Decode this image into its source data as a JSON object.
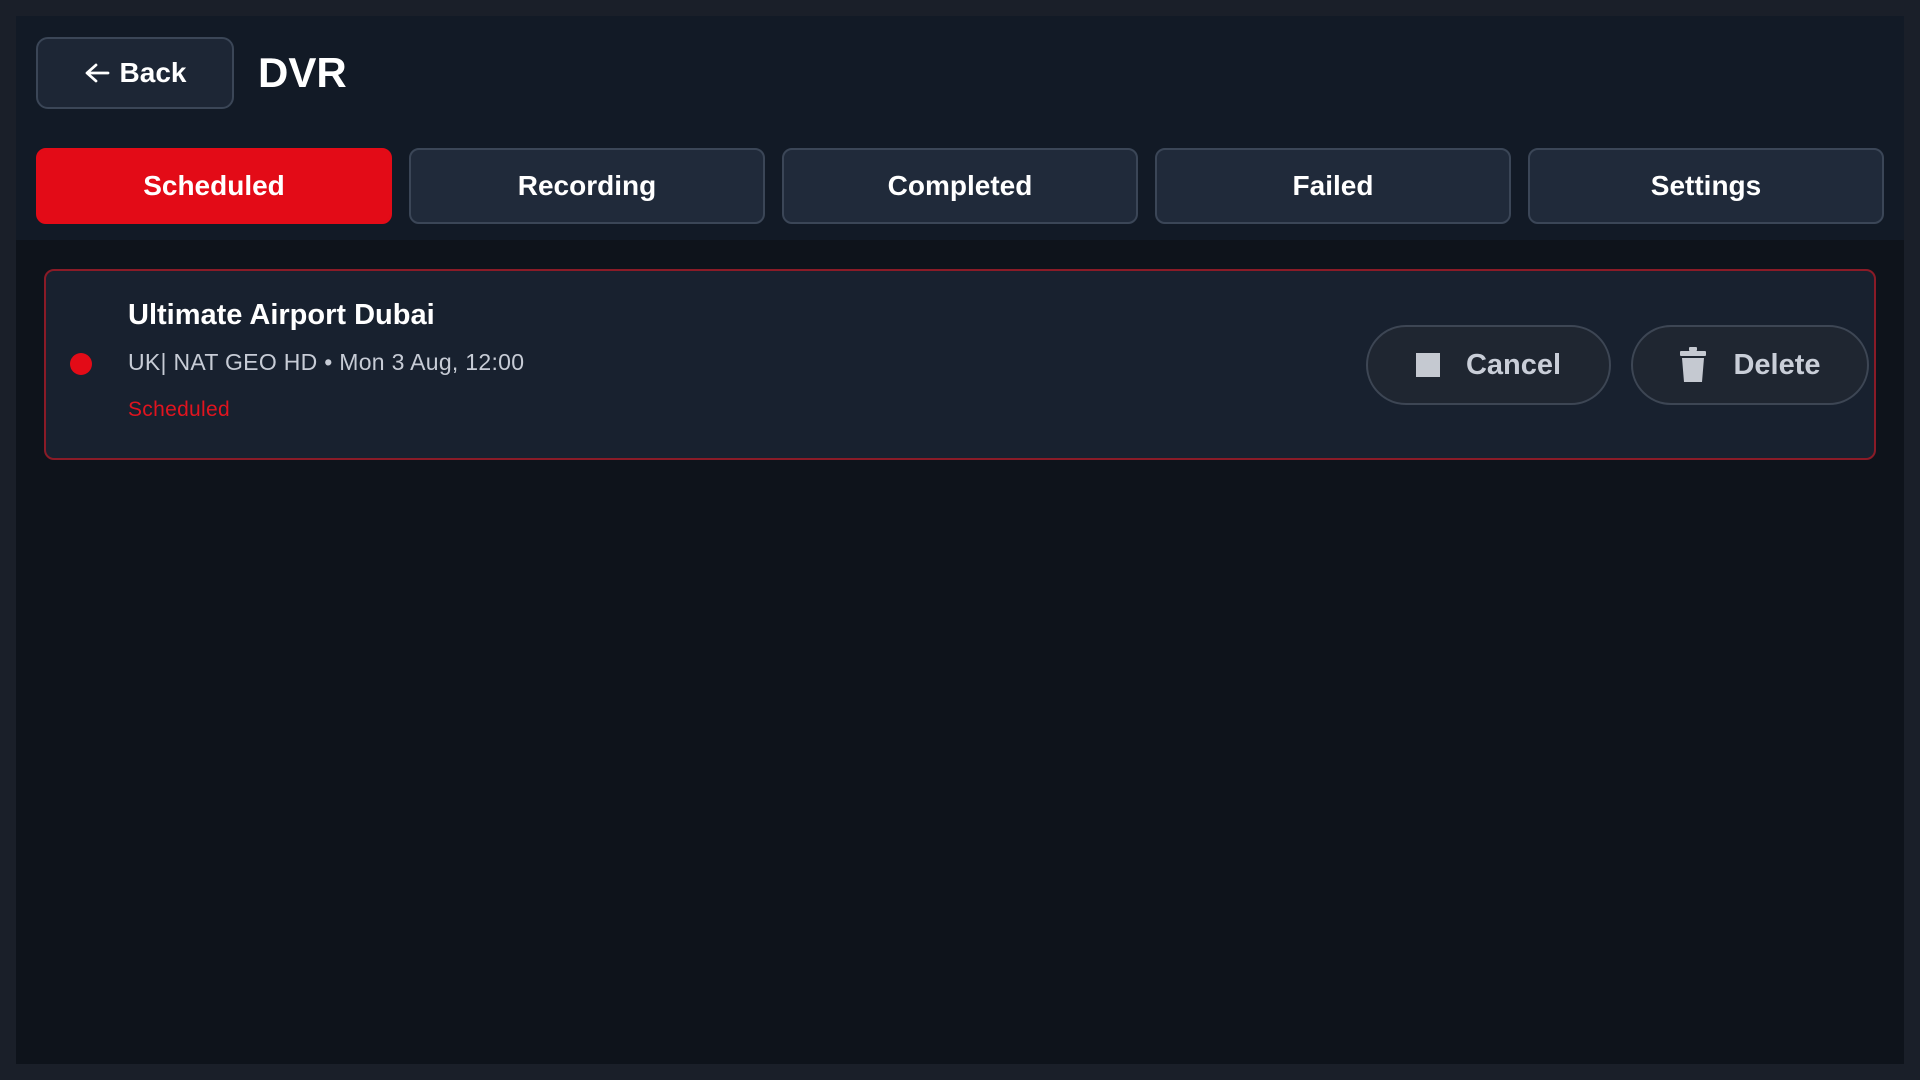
{
  "header": {
    "back_label": "Back",
    "title": "DVR"
  },
  "tabs": [
    {
      "label": "Scheduled",
      "active": true
    },
    {
      "label": "Recording",
      "active": false
    },
    {
      "label": "Completed",
      "active": false
    },
    {
      "label": "Failed",
      "active": false
    },
    {
      "label": "Settings",
      "active": false
    }
  ],
  "recordings": [
    {
      "title": "Ultimate Airport Dubai",
      "meta": "UK| NAT GEO HD • Mon 3 Aug, 12:00",
      "status": "Scheduled",
      "status_color": "#e30b17",
      "actions": {
        "cancel_label": "Cancel",
        "cancel_icon": "stop-icon",
        "delete_label": "Delete",
        "delete_icon": "trash-icon"
      }
    }
  ],
  "colors": {
    "accent": "#e30b17",
    "background": "#0e131b",
    "header_background": "#121a26"
  },
  "icons": {
    "back": "arrow-left-icon"
  }
}
